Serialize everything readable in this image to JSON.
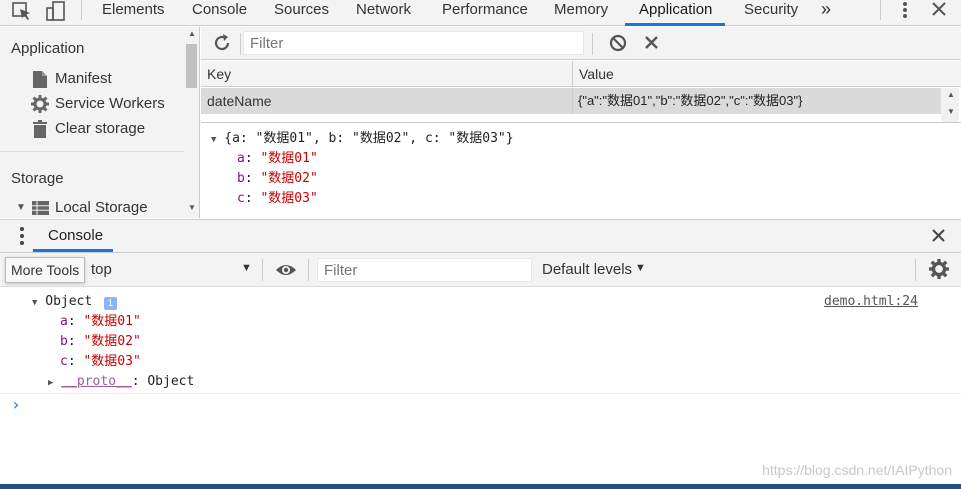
{
  "topbar": {
    "tabs": [
      {
        "label": "Elements"
      },
      {
        "label": "Console"
      },
      {
        "label": "Sources"
      },
      {
        "label": "Network"
      },
      {
        "label": "Performance"
      },
      {
        "label": "Memory"
      },
      {
        "label": "Application",
        "active": true
      },
      {
        "label": "Security"
      }
    ],
    "overflow_label": "»"
  },
  "sidebar": {
    "application_header": "Application",
    "application_items": [
      {
        "label": "Manifest",
        "icon": "document-icon"
      },
      {
        "label": "Service Workers",
        "icon": "gear-icon"
      },
      {
        "label": "Clear storage",
        "icon": "trash-icon"
      }
    ],
    "storage_header": "Storage",
    "storage_items": [
      {
        "label": "Local Storage",
        "icon": "grid-icon",
        "expanded": true
      }
    ]
  },
  "storage": {
    "filter_placeholder": "Filter",
    "columns": [
      "Key",
      "Value"
    ],
    "rows": [
      {
        "key": "dateName",
        "value": "{\"a\":\"数据01\",\"b\":\"数据02\",\"c\":\"数据03\"}"
      }
    ]
  },
  "preview": {
    "summary": "{a: \"数据01\", b: \"数据02\", c: \"数据03\"}",
    "props": [
      {
        "key": "a",
        "value": "\"数据01\""
      },
      {
        "key": "b",
        "value": "\"数据02\""
      },
      {
        "key": "c",
        "value": "\"数据03\""
      }
    ]
  },
  "drawer": {
    "tab_label": "Console",
    "tooltip": "More Tools"
  },
  "console_toolbar": {
    "context": "top",
    "filter_placeholder": "Filter",
    "levels": "Default levels"
  },
  "console": {
    "object_label": "Object",
    "source_link": "demo.html:24",
    "props": [
      {
        "key": "a",
        "value": "\"数据01\""
      },
      {
        "key": "b",
        "value": "\"数据02\""
      },
      {
        "key": "c",
        "value": "\"数据03\""
      }
    ],
    "proto_key": "__proto__",
    "proto_value": "Object",
    "prompt": "›"
  },
  "watermark": "https://blog.csdn.net/IAIPython",
  "colors": {
    "accent": "#1a73e8",
    "key": "#881280",
    "string": "#c80000",
    "selected_row": "#dadada"
  }
}
